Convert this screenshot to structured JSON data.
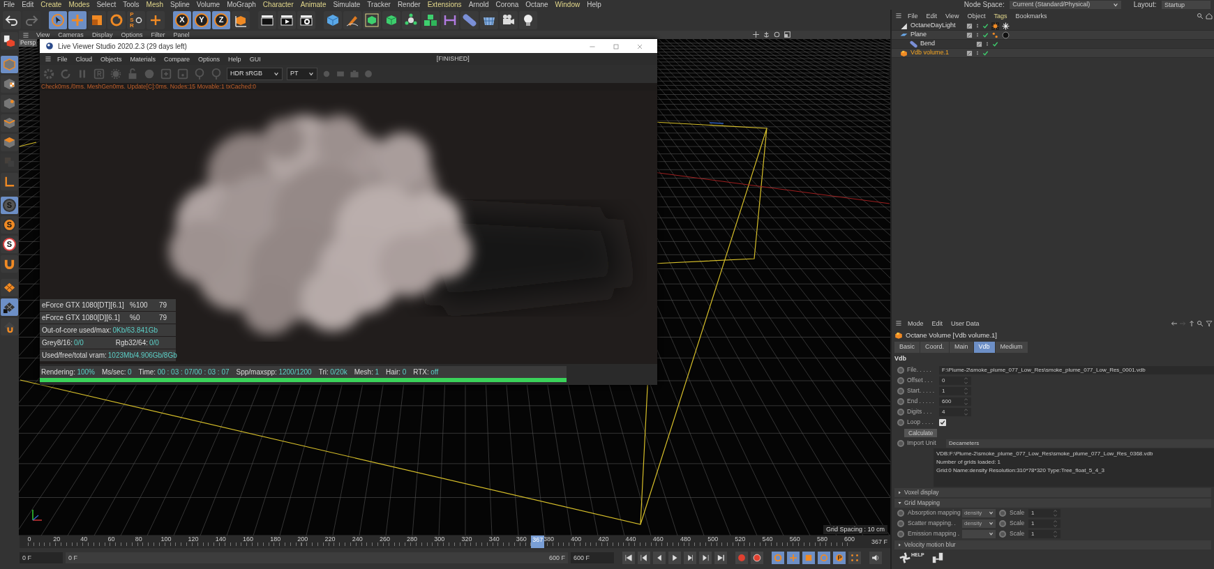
{
  "menu": [
    {
      "label": "File",
      "highlighted": false
    },
    {
      "label": "Edit",
      "highlighted": false
    },
    {
      "label": "Create",
      "highlighted": true
    },
    {
      "label": "Modes",
      "highlighted": true
    },
    {
      "label": "Select",
      "highlighted": false
    },
    {
      "label": "Tools",
      "highlighted": false
    },
    {
      "label": "Mesh",
      "highlighted": true
    },
    {
      "label": "Spline",
      "highlighted": false
    },
    {
      "label": "Volume",
      "highlighted": false
    },
    {
      "label": "MoGraph",
      "highlighted": false
    },
    {
      "label": "Character",
      "highlighted": true
    },
    {
      "label": "Animate",
      "highlighted": true
    },
    {
      "label": "Simulate",
      "highlighted": false
    },
    {
      "label": "Tracker",
      "highlighted": false
    },
    {
      "label": "Render",
      "highlighted": false
    },
    {
      "label": "Extensions",
      "highlighted": true
    },
    {
      "label": "Arnold",
      "highlighted": false
    },
    {
      "label": "Corona",
      "highlighted": false
    },
    {
      "label": "Octane",
      "highlighted": false
    },
    {
      "label": "Window",
      "highlighted": true
    },
    {
      "label": "Help",
      "highlighted": false
    }
  ],
  "node_space": {
    "label": "Node Space:",
    "value": "Current (Standard/Physical)"
  },
  "layout": {
    "label": "Layout:",
    "value": "Startup"
  },
  "toolbar": [
    {
      "active": false,
      "disabled": false
    },
    {
      "active": false,
      "disabled": true
    },
    {
      "active": true,
      "disabled": false
    },
    {
      "active": true,
      "disabled": false
    },
    {
      "active": false,
      "disabled": false
    },
    {
      "active": false,
      "disabled": false
    },
    {
      "active": false,
      "disabled": false,
      "label": "PSR"
    },
    {
      "active": false,
      "disabled": false
    },
    {
      "active": true,
      "disabled": false,
      "label": "X"
    },
    {
      "active": true,
      "disabled": false,
      "label": "Y"
    },
    {
      "active": true,
      "disabled": false,
      "label": "Z"
    },
    {
      "active": false,
      "disabled": false
    },
    {
      "active": false,
      "disabled": false
    },
    {
      "active": false,
      "disabled": false
    },
    {
      "active": false,
      "disabled": false
    },
    {
      "active": false,
      "disabled": false
    },
    {
      "active": false,
      "disabled": false
    },
    {
      "active": false,
      "disabled": false
    },
    {
      "active": false,
      "disabled": false
    },
    {
      "active": false,
      "disabled": false
    },
    {
      "active": false,
      "disabled": false
    },
    {
      "active": false,
      "disabled": false
    },
    {
      "active": false,
      "disabled": false
    },
    {
      "active": false,
      "disabled": false
    },
    {
      "active": false,
      "disabled": false
    },
    {
      "active": false,
      "disabled": false
    }
  ],
  "left_toolbar": [
    {
      "active": false,
      "disabled": false
    },
    {
      "active": true,
      "disabled": false
    },
    {
      "active": false,
      "disabled": false
    },
    {
      "active": false,
      "disabled": false
    },
    {
      "active": false,
      "disabled": false
    },
    {
      "active": false,
      "disabled": false
    },
    {
      "active": false,
      "disabled": true
    },
    {
      "active": false,
      "disabled": false
    },
    {
      "active": true,
      "disabled": false,
      "label": "S"
    },
    {
      "active": false,
      "disabled": false,
      "label": "S"
    },
    {
      "active": false,
      "disabled": false,
      "label": "S"
    },
    {
      "active": false,
      "disabled": false
    },
    {
      "active": false,
      "disabled": false
    },
    {
      "active": true,
      "disabled": false
    },
    {
      "active": false,
      "disabled": false
    }
  ],
  "viewport": {
    "menu": [
      "View",
      "Cameras",
      "Display",
      "Options",
      "Filter",
      "Panel"
    ],
    "camera_label": "Persp",
    "grid_spacing": "Grid Spacing : 10 cm"
  },
  "live_viewer": {
    "title": "Live Viewer Studio 2020.2.3 (29 days left)",
    "menu": [
      "File",
      "Cloud",
      "Objects",
      "Materials",
      "Compare",
      "Options",
      "Help",
      "GUI"
    ],
    "state": "[FINISHED]",
    "dropdowns": [
      "HDR sRGB",
      "PT"
    ],
    "info_line": "Check0ms./0ms. MeshGen0ms. Update[C]:0ms. Nodes:15 Movable:1 txCached:0",
    "gpus": [
      {
        "name": "eForce GTX 1080[DT][6.1]",
        "usage": "%100",
        "temp": "79"
      },
      {
        "name": "eForce GTX 1080[D][6.1]",
        "usage": "%0",
        "temp": "79"
      }
    ],
    "memory": [
      [
        {
          "label": "Out-of-core used/max:",
          "value": "0Kb/63.841Gb"
        }
      ],
      [
        {
          "label": "Grey8/16:",
          "value": "0/0"
        },
        {
          "label": "Rgb32/64:",
          "value": "0/0"
        }
      ],
      [
        {
          "label": "Used/free/total vram:",
          "value": "1023Mb/4.906Gb/8Gb"
        }
      ]
    ],
    "status": [
      {
        "label": "Rendering:",
        "value": "100%"
      },
      {
        "label": "Ms/sec:",
        "value": "0"
      },
      {
        "label": "Time:",
        "value": "00 : 03 : 07/00 : 03 : 07"
      },
      {
        "label": "Spp/maxspp:",
        "value": "1200/1200"
      },
      {
        "label": "Tri:",
        "value": "0/20k"
      },
      {
        "label": "Mesh:",
        "value": "1"
      },
      {
        "label": "Hair:",
        "value": "0"
      },
      {
        "label": "RTX:",
        "value": "off"
      }
    ],
    "progress": {
      "level": 1.0
    }
  },
  "timeline": {
    "ruler": [
      "0",
      "20",
      "40",
      "60",
      "80",
      "100",
      "120",
      "140",
      "160",
      "180",
      "200",
      "220",
      "240",
      "260",
      "280",
      "300",
      "320",
      "340",
      "360",
      "380",
      "400",
      "420",
      "440",
      "460",
      "480",
      "500",
      "520",
      "540",
      "560",
      "580",
      "600"
    ],
    "playhead": {
      "label": "367",
      "level": 0.6117
    },
    "current_frame": "367 F",
    "start_field": "0 F",
    "range_start": "0 F",
    "range_end": "600 F",
    "end_field": "600 F"
  },
  "object_manager": {
    "menu": [
      {
        "label": "File",
        "highlighted": false
      },
      {
        "label": "Edit",
        "highlighted": false
      },
      {
        "label": "View",
        "highlighted": false
      },
      {
        "label": "Object",
        "highlighted": false
      },
      {
        "label": "Tags",
        "highlighted": true
      },
      {
        "label": "Bookmarks",
        "highlighted": false
      }
    ],
    "objects": [
      {
        "name": "OctaneDayLight",
        "kind": "light",
        "selected": false
      },
      {
        "name": "Plane",
        "kind": "plane",
        "selected": false,
        "children": [
          {
            "name": "Bend",
            "kind": "deformer",
            "selected": false
          }
        ]
      },
      {
        "name": "Vdb volume.1",
        "kind": "volume",
        "selected": true
      }
    ]
  },
  "attributes": {
    "menu": [
      "Mode",
      "Edit",
      "User Data"
    ],
    "title": "Octane Volume [Vdb volume.1]",
    "tabs": [
      {
        "label": "Basic",
        "selected": false
      },
      {
        "label": "Coord.",
        "selected": false
      },
      {
        "label": "Main",
        "selected": false
      },
      {
        "label": "Vdb",
        "selected": true
      },
      {
        "label": "Medium",
        "selected": false
      }
    ],
    "group": "Vdb",
    "fields": [
      {
        "kind": "text",
        "label": "File. . . . .",
        "value": "F:\\Plume-2\\smoke_plume_077_Low_Res\\smoke_plume_077_Low_Res_0001.vdb"
      },
      {
        "kind": "number",
        "label": "Offset . . .",
        "value": "0"
      },
      {
        "kind": "number",
        "label": "Start. . . . .",
        "value": "1"
      },
      {
        "kind": "number",
        "label": "End . . . . .",
        "value": "600"
      },
      {
        "kind": "number",
        "label": "Digits . . .",
        "value": "4"
      },
      {
        "kind": "checkbox",
        "label": "Loop . . . .",
        "checked": true
      },
      {
        "kind": "button",
        "label": "Calculate"
      },
      {
        "kind": "select",
        "label": "Import Unit",
        "value": "Decameters"
      }
    ],
    "info": [
      "VDB:F:\\Plume-2\\smoke_plume_077_Low_Res\\smoke_plume_077_Low_Res_0368.vdb",
      "Number of grids loaded: 1",
      "Grid:0  Name:density  Resolution:310*78*320  Type:Tree_float_5_4_3"
    ],
    "sections": [
      {
        "title": "Voxel display",
        "expanded": false
      },
      {
        "title": "Grid Mapping",
        "expanded": true,
        "rows": [
          {
            "label": "Absorption mapping",
            "channel": "density",
            "scale_label": "Scale",
            "scale": "1"
          },
          {
            "label": "Scatter mapping. .",
            "channel": "density",
            "scale_label": "Scale",
            "scale": "1"
          },
          {
            "label": "Emission mapping .",
            "scale_label": "Scale",
            "scale": "1"
          }
        ]
      },
      {
        "title": "Velocity motion blur",
        "expanded": false
      }
    ],
    "help_label": "HELP"
  }
}
